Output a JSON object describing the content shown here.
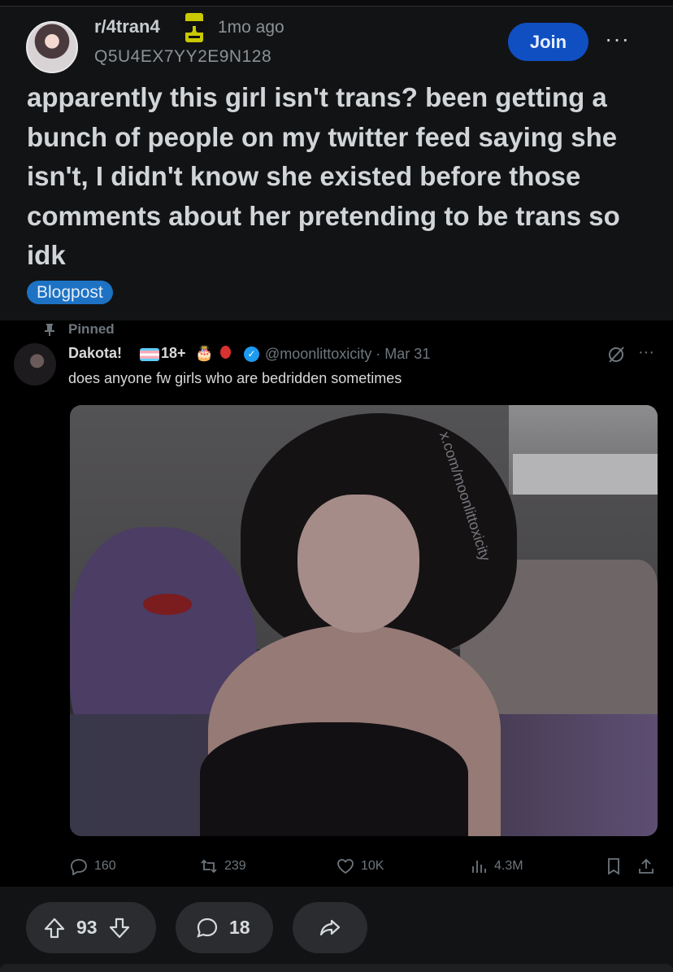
{
  "post": {
    "subreddit": "r/4tran4",
    "age": "1mo ago",
    "username": "Q5U4EX7YY2E9N128",
    "join_label": "Join",
    "more_label": "···",
    "title": "apparently this girl isn't trans? been getting a bunch of people on my twitter feed saying she isn't, I didn't know she existed before those comments about her pretending to be trans so idk",
    "flair": "Blogpost"
  },
  "tweet": {
    "pinned_label": "Pinned",
    "name": "Dakota!",
    "age_badge": "18+",
    "cake_emoji": "🎂",
    "verified_mark": "✓",
    "handle_date": "@moonlittoxicity · Mar 31",
    "text": "does anyone fw girls who are bedridden sometimes",
    "more_label": "···",
    "watermark": "x.com/moonlittoxicity",
    "replies": "160",
    "retweets": "239",
    "likes": "10K",
    "views": "4.3M"
  },
  "footer": {
    "upvotes": "93",
    "comments": "18"
  },
  "colors": {
    "join_bg": "#0f4fc2",
    "flair_bg": "#1d72c4",
    "verified": "#1d9bf0"
  }
}
